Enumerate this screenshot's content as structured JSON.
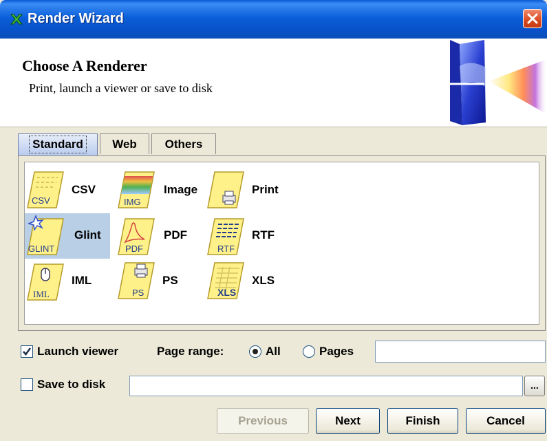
{
  "window": {
    "title": "Render Wizard"
  },
  "header": {
    "title": "Choose A Renderer",
    "subtitle": "Print, launch a viewer or save to disk"
  },
  "tabs": [
    {
      "label": "Standard",
      "active": true
    },
    {
      "label": "Web",
      "active": false
    },
    {
      "label": "Others",
      "active": false
    }
  ],
  "renderers": [
    {
      "label": "CSV",
      "icon_text": "CSV",
      "selected": false
    },
    {
      "label": "Image",
      "icon_text": "IMG",
      "selected": false
    },
    {
      "label": "Print",
      "icon_text": "",
      "selected": false
    },
    {
      "label": "Glint",
      "icon_text": "GLINT",
      "selected": true
    },
    {
      "label": "PDF",
      "icon_text": "PDF",
      "selected": false
    },
    {
      "label": "RTF",
      "icon_text": "RTF",
      "selected": false
    },
    {
      "label": "IML",
      "icon_text": "IML",
      "selected": false
    },
    {
      "label": "PS",
      "icon_text": "PS",
      "selected": false
    },
    {
      "label": "XLS",
      "icon_text": "XLS",
      "selected": false
    }
  ],
  "options": {
    "launch_viewer_label": "Launch viewer",
    "launch_viewer_checked": true,
    "page_range_label": "Page range:",
    "radio_all_label": "All",
    "radio_pages_label": "Pages",
    "page_range_selected": "All",
    "pages_value": "",
    "save_to_disk_label": "Save to disk",
    "save_to_disk_checked": false,
    "save_path_value": "",
    "browse_label": "..."
  },
  "buttons": {
    "previous": "Previous",
    "next": "Next",
    "finish": "Finish",
    "cancel": "Cancel"
  },
  "colors": {
    "titlebar": "#0a5ad6",
    "selection": "#b8cfe5",
    "icon_yellow": "#fff18a"
  }
}
